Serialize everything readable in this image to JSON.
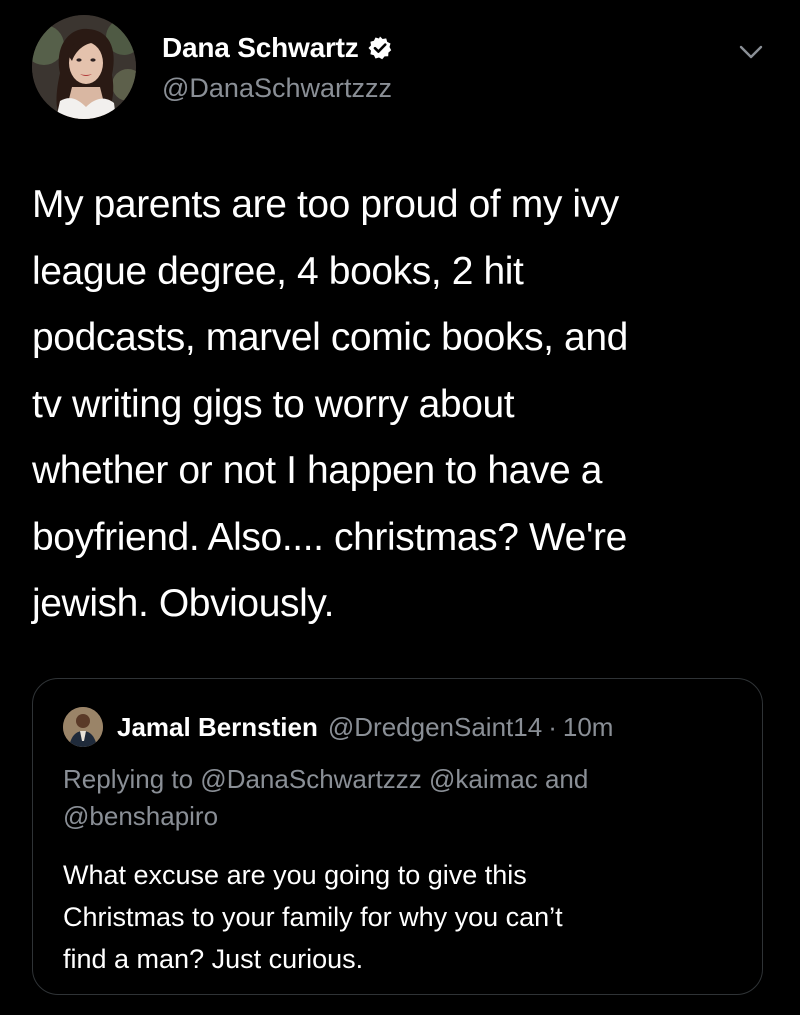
{
  "author": {
    "name": "Dana Schwartz",
    "handle": "@DanaSchwartzzz",
    "verified": true,
    "avatar_icon": "profile-photo"
  },
  "menu": {
    "icon": "chevron-down-icon"
  },
  "tweet": {
    "lines": [
      "My parents are too proud of my ivy",
      "league degree, 4 books, 2 hit",
      "podcasts, marvel comic books, and",
      "tv writing gigs to worry about",
      "whether or not I happen to have a",
      "boyfriend. Also.... christmas? We're",
      "jewish. Obviously."
    ]
  },
  "quoted": {
    "name": "Jamal Bernstien",
    "handle": "@DredgenSaint14",
    "separator": "·",
    "time": "10m",
    "reply_lines": [
      "Replying to @DanaSchwartzzz @kaimac and",
      "@benshapiro"
    ],
    "text_lines": [
      "What excuse are you going to give this",
      "Christmas to your family for why you can’t",
      "find a man? Just curious."
    ]
  },
  "colors": {
    "background": "#000000",
    "primary_text": "#ffffff",
    "secondary_text": "#8a8f96",
    "card_border": "#2f3336"
  }
}
